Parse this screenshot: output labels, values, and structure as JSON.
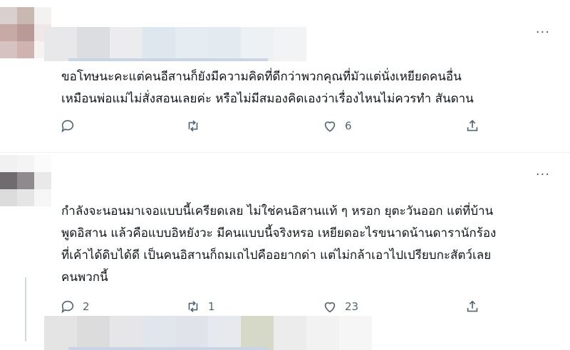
{
  "tweets": [
    {
      "text_lines": [
        "ขอโทษนะคะแต่คนอีสานก็ยังมีความคิดที่ดีกว่าพวกคุณที่มัวแต่นั่งเหยียดคนอื่น",
        "เหมือนพ่อแม่ไม่สั่งสอนเลยค่ะ หรือไม่มีสมองคิดเองว่าเรื่องไหนไม่ควรทำ สันดาน"
      ],
      "more_label": "···",
      "reply_count": "",
      "retweet_count": "",
      "like_count": "6"
    },
    {
      "text_lines": [
        "กำลังจะนอนมาเจอแบบนี้เครียดเลย ไม่ใช่คนอิสานแท้ ๆ หรอก ยุตะวันออก แต่ที่บ้าน",
        "พูดอิสาน แล้วคือแบบอิหยังวะ มีคนแบบนี้จริงหรอ เหยียดอะไรขนาดน้านดารานักร้อง",
        "ที่เค้าได้ดิบได้ดี เป็นคนอิสานก็ถมเถไปคืออยากด่า แต่ไม่กล้าเอาไปเปรียบกะสัตว์เลย",
        "คนพวกนี้"
      ],
      "more_label": "···",
      "reply_count": "2",
      "retweet_count": "1",
      "like_count": "23"
    }
  ],
  "icons": [
    "reply-icon",
    "retweet-icon",
    "like-icon",
    "share-icon",
    "more-icon"
  ],
  "colors": {
    "icon": "#536471",
    "text": "#0f1419",
    "divider": "#eff3f4"
  }
}
